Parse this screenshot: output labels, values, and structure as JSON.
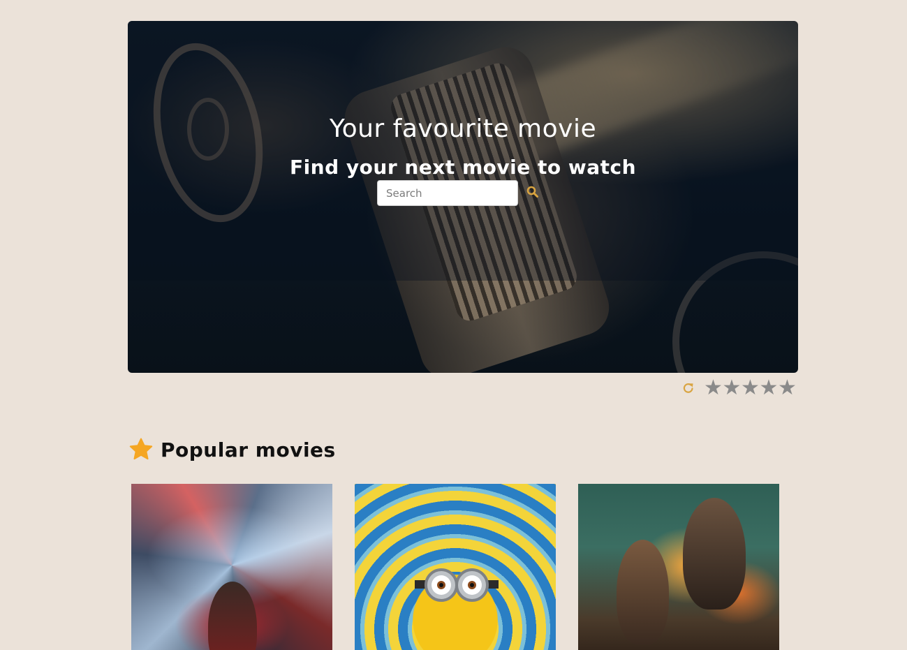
{
  "hero": {
    "title": "Your favourite movie",
    "subtitle": "Find your next movie to watch",
    "search": {
      "placeholder": "Search",
      "value": ""
    },
    "search_icon": "search-icon"
  },
  "rating": {
    "reset_icon": "reset-icon",
    "stars": [
      "★",
      "★",
      "★",
      "★",
      "★"
    ],
    "value": 0,
    "max": 5,
    "color": "#8a8a8a"
  },
  "popular": {
    "icon": "star-icon",
    "title": "Popular movies",
    "posters": [
      "poster-1",
      "poster-2",
      "poster-3"
    ]
  },
  "colors": {
    "background": "#ebe2d9",
    "accent": "#d9a441",
    "star_accent": "#f5a623"
  }
}
